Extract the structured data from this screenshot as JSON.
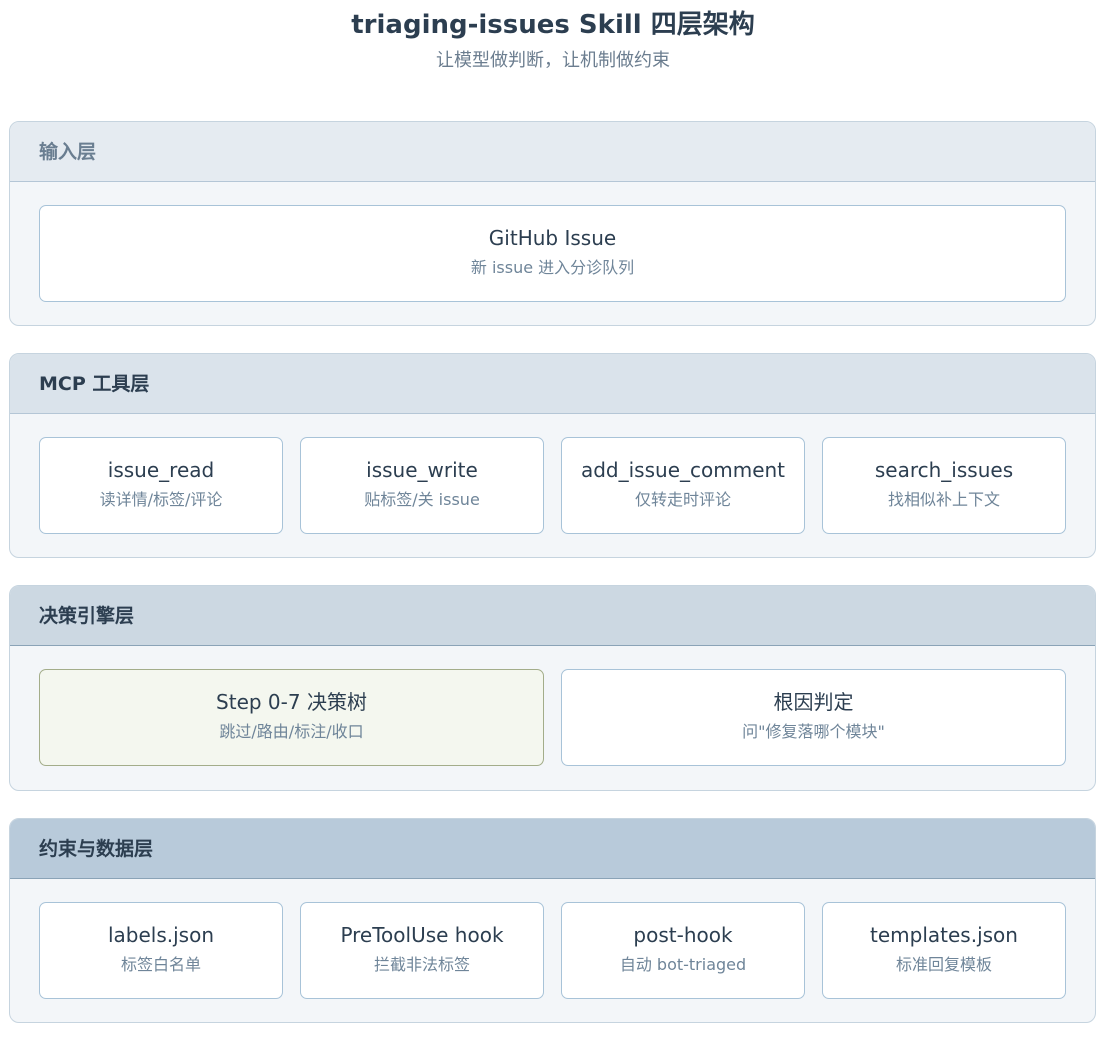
{
  "header": {
    "title": "triaging-issues Skill 四层架构",
    "subtitle": "让模型做判断，让机制做约束"
  },
  "layers": [
    {
      "label": "输入层",
      "cards": [
        {
          "title": "GitHub Issue",
          "desc": "新 issue 进入分诊队列"
        }
      ]
    },
    {
      "label": "MCP 工具层",
      "cards": [
        {
          "title": "issue_read",
          "desc": "读详情/标签/评论"
        },
        {
          "title": "issue_write",
          "desc": "贴标签/关 issue"
        },
        {
          "title": "add_issue_comment",
          "desc": "仅转走时评论"
        },
        {
          "title": "search_issues",
          "desc": "找相似补上下文"
        }
      ]
    },
    {
      "label": "决策引擎层",
      "cards": [
        {
          "title": "Step 0-7 决策树",
          "desc": "跳过/路由/标注/收口"
        },
        {
          "title": "根因判定",
          "desc": "问\"修复落哪个模块\""
        }
      ]
    },
    {
      "label": "约束与数据层",
      "cards": [
        {
          "title": "labels.json",
          "desc": "标签白名单"
        },
        {
          "title": "PreToolUse hook",
          "desc": "拦截非法标签"
        },
        {
          "title": "post-hook",
          "desc": "自动 bot-triaged"
        },
        {
          "title": "templates.json",
          "desc": "标准回复模板"
        }
      ]
    }
  ]
}
